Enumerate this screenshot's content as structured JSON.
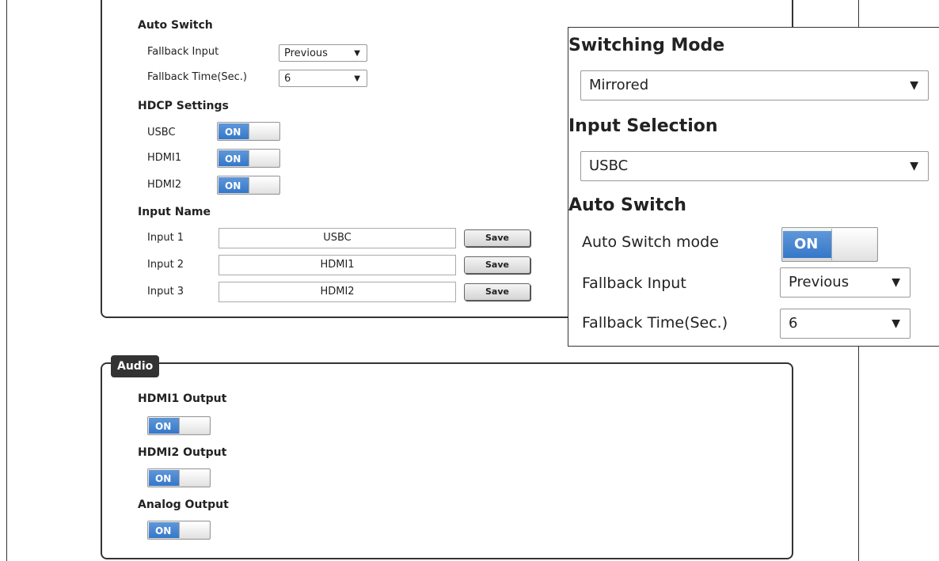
{
  "video": {
    "auto_switch_heading": "Auto Switch",
    "fallback_input_label": "Fallback Input",
    "fallback_input_value": "Previous",
    "fallback_time_label": "Fallback Time(Sec.)",
    "fallback_time_value": "6",
    "hdcp_heading": "HDCP Settings",
    "hdcp": [
      {
        "label": "USBC",
        "state": "ON"
      },
      {
        "label": "HDMI1",
        "state": "ON"
      },
      {
        "label": "HDMI2",
        "state": "ON"
      }
    ],
    "input_name_heading": "Input Name",
    "inputs": [
      {
        "label": "Input 1",
        "value": "USBC",
        "save": "Save"
      },
      {
        "label": "Input 2",
        "value": "HDMI1",
        "save": "Save"
      },
      {
        "label": "Input 3",
        "value": "HDMI2",
        "save": "Save"
      }
    ]
  },
  "audio": {
    "legend": "Audio",
    "outputs": [
      {
        "label": "HDMI1 Output",
        "state": "ON"
      },
      {
        "label": "HDMI2 Output",
        "state": "ON"
      },
      {
        "label": "Analog Output",
        "state": "ON"
      }
    ]
  },
  "zoom": {
    "switching_mode_heading": "Switching Mode",
    "switching_mode_value": "Mirrored",
    "input_selection_heading": "Input Selection",
    "input_selection_value": "USBC",
    "auto_switch_heading": "Auto Switch",
    "auto_switch_mode_label": "Auto Switch mode",
    "auto_switch_mode_state": "ON",
    "fallback_input_label": "Fallback Input",
    "fallback_input_value": "Previous",
    "fallback_time_label": "Fallback Time(Sec.)",
    "fallback_time_value": "6"
  },
  "icons": {
    "dropdown_arrow": "▼"
  }
}
